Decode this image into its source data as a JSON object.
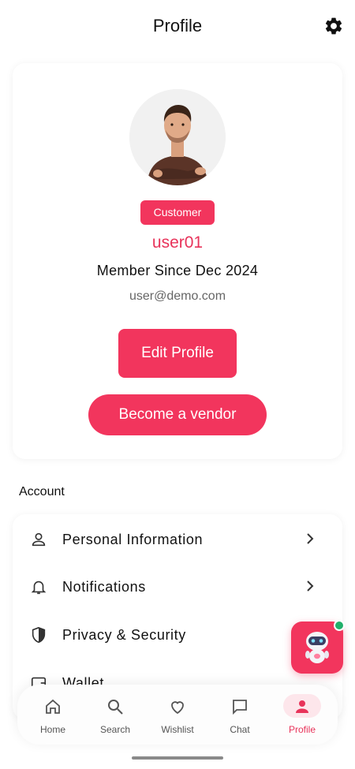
{
  "header": {
    "title": "Profile",
    "settings_icon": "gear-icon"
  },
  "profile": {
    "role_badge": "Customer",
    "username": "user01",
    "member_since": "Member Since Dec 2024",
    "email": "user@demo.com",
    "edit_button": "Edit Profile",
    "vendor_button": "Become a vendor"
  },
  "account": {
    "section_title": "Account",
    "items": [
      {
        "label": "Personal Information",
        "icon": "person-icon"
      },
      {
        "label": "Notifications",
        "icon": "bell-icon"
      },
      {
        "label": "Privacy & Security",
        "icon": "shield-icon"
      },
      {
        "label": "Wallet",
        "icon": "wallet-icon"
      }
    ]
  },
  "bottom_nav": {
    "items": [
      {
        "label": "Home",
        "icon": "home-icon"
      },
      {
        "label": "Search",
        "icon": "search-icon"
      },
      {
        "label": "Wishlist",
        "icon": "heart-icon"
      },
      {
        "label": "Chat",
        "icon": "chat-icon"
      },
      {
        "label": "Profile",
        "icon": "person-icon",
        "active": true
      }
    ]
  },
  "colors": {
    "accent": "#f2355d",
    "accent_text": "#e8335a",
    "online_dot": "#22b06b"
  }
}
